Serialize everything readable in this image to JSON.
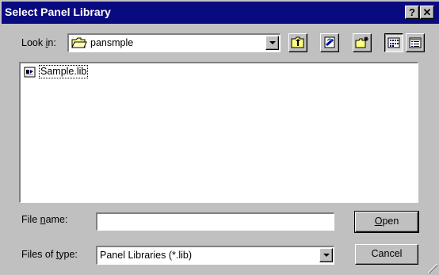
{
  "window": {
    "title": "Select Panel Library",
    "help_label": "?",
    "close_label": "✕"
  },
  "look_in": {
    "label_pre": "Look ",
    "label_accel": "i",
    "label_post": "n:",
    "value": "pansmple",
    "icon": "folder-icon"
  },
  "toolbar": {
    "buttons": [
      {
        "name": "up-one-level",
        "icon": "up-folder-icon"
      },
      {
        "name": "desktop",
        "icon": "desktop-icon"
      },
      {
        "name": "new-folder",
        "icon": "new-folder-icon"
      },
      {
        "name": "list-view",
        "icon": "list-view-icon",
        "pressed": true
      },
      {
        "name": "details-view",
        "icon": "details-view-icon"
      }
    ]
  },
  "files": [
    {
      "name": "Sample.lib",
      "icon": "library-file-icon"
    }
  ],
  "file_name": {
    "label_pre": "File ",
    "label_accel": "n",
    "label_post": "ame:",
    "value": "",
    "placeholder": ""
  },
  "file_type": {
    "label_pre": "Files of ",
    "label_accel": "t",
    "label_post": "ype:",
    "value": "Panel Libraries (*.lib)"
  },
  "buttons": {
    "open_accel": "O",
    "open_rest": "pen",
    "cancel": "Cancel"
  },
  "colors": {
    "titlebar": "#0a0a80",
    "face": "#c0c0c0"
  }
}
